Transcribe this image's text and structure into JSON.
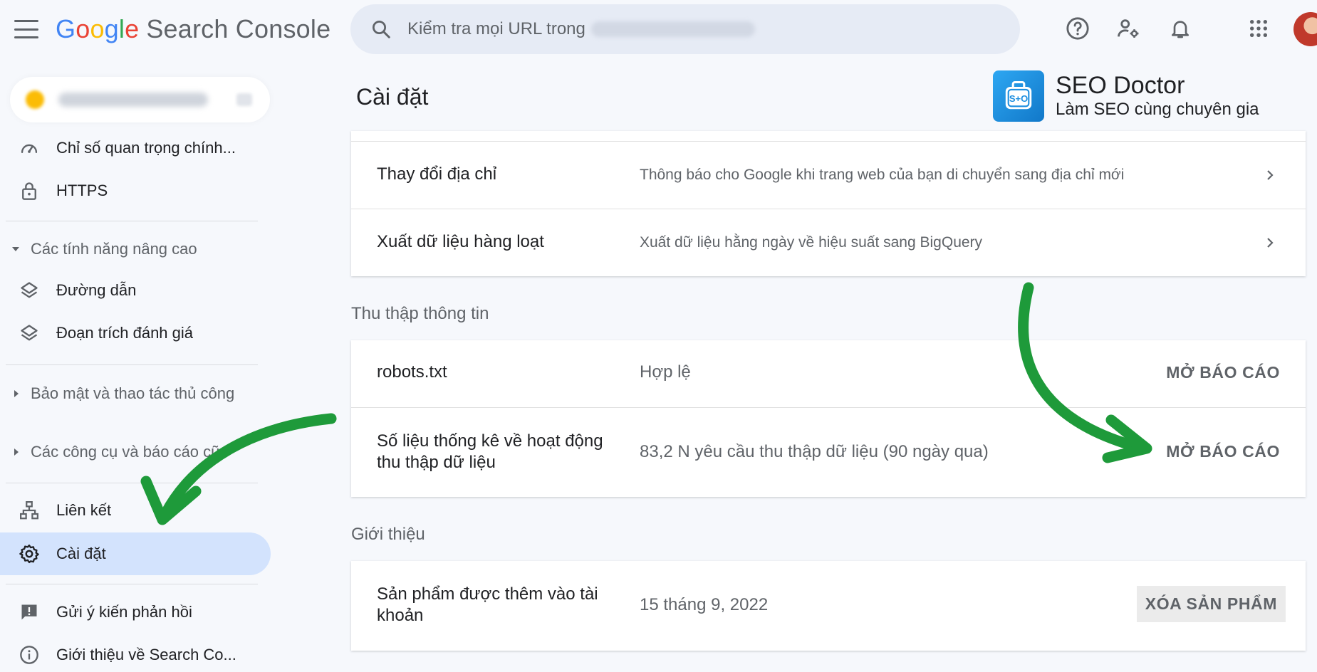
{
  "header": {
    "logo_letters": [
      "G",
      "o",
      "o",
      "g",
      "l",
      "e"
    ],
    "logo_product": "Search Console",
    "search_placeholder": "Kiểm tra mọi URL trong"
  },
  "sidebar": {
    "items_top": [
      {
        "label": "Chỉ số quan trọng chính...",
        "icon": "speed-gauge-icon"
      },
      {
        "label": "HTTPS",
        "icon": "lock-icon"
      }
    ],
    "sections": [
      {
        "label": "Các tính năng nâng cao",
        "expanded": true
      },
      {
        "label": "Bảo mật và thao tác thủ công",
        "expanded": false
      },
      {
        "label": "Các công cụ và báo cáo cũ",
        "expanded": false
      }
    ],
    "advanced_items": [
      {
        "label": "Đường dẫn",
        "icon": "layers-icon"
      },
      {
        "label": "Đoạn trích đánh giá",
        "icon": "layers-icon"
      }
    ],
    "bottom_items": [
      {
        "label": "Liên kết",
        "icon": "sitemap-icon"
      },
      {
        "label": "Cài đặt",
        "icon": "gear-icon",
        "active": true
      }
    ],
    "footer_items": [
      {
        "label": "Gửi ý kiến phản hồi",
        "icon": "feedback-icon"
      },
      {
        "label": "Giới thiệu về Search Co...",
        "icon": "info-icon"
      }
    ]
  },
  "main": {
    "title": "Cài đặt",
    "badge": {
      "name": "SEO Doctor",
      "tagline": "Làm SEO cùng chuyên gia",
      "logo_text": "S+O"
    },
    "top_card": [
      {
        "name": "Thay đổi địa chỉ",
        "desc": "Thông báo cho Google khi trang web của bạn di chuyển sang địa chỉ mới"
      },
      {
        "name": "Xuất dữ liệu hàng loạt",
        "desc": "Xuất dữ liệu hằng ngày về hiệu suất sang BigQuery"
      }
    ],
    "crawl_section": {
      "label": "Thu thập thông tin",
      "rows": [
        {
          "name": "robots.txt",
          "value": "Hợp lệ",
          "action": "MỞ BÁO CÁO"
        },
        {
          "name_line1": "Số liệu thống kê về hoạt động",
          "name_line2": "thu thập dữ liệu",
          "value": "83,2 N yêu cầu thu thập dữ liệu (90 ngày qua)",
          "action": "MỞ BÁO CÁO"
        }
      ]
    },
    "about_section": {
      "label": "Giới thiệu",
      "rows": [
        {
          "name_line1": "Sản phẩm được thêm vào tài",
          "name_line2": "khoản",
          "value": "15 tháng 9, 2022",
          "action": "XÓA SẢN PHẨM"
        }
      ]
    }
  },
  "colors": {
    "accent_active": "#d3e3fd",
    "arrow": "#1e9a3a",
    "seo_blue": "#1e8fe0"
  }
}
